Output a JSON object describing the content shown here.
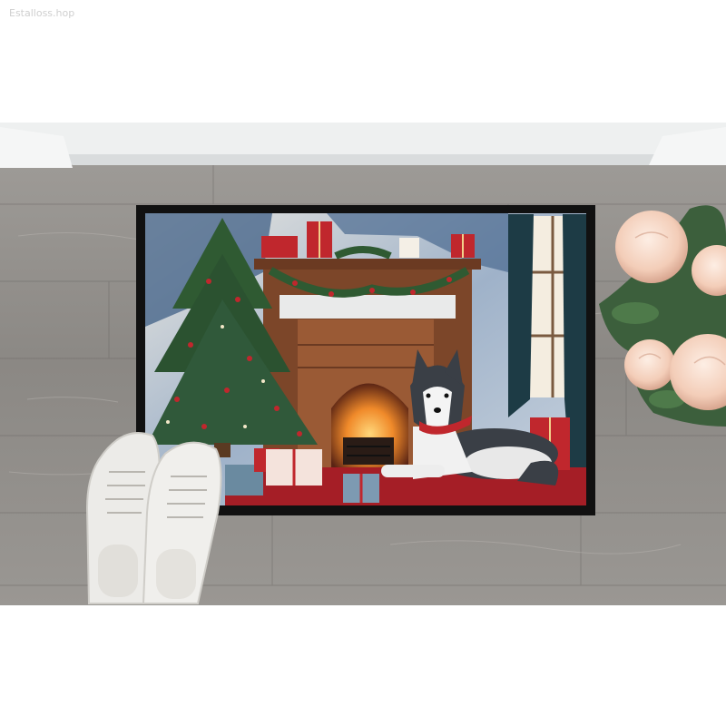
{
  "watermark": "Estalloss.hop",
  "colors": {
    "floor": "#8f8c89",
    "mat_border": "#111111",
    "wall": "#3f5f86",
    "fireplace_brick": "#8a4e2f",
    "tree": "#2f5a32",
    "rug": "#a51e26",
    "gift_red": "#c0272d",
    "flower": "#f3cdb8",
    "curtain": "#1d3b45"
  },
  "icons": [
    "sneakers-icon",
    "christmas-tree-icon",
    "fireplace-icon",
    "husky-dog-icon",
    "gift-box-icon",
    "peony-flower-icon"
  ]
}
